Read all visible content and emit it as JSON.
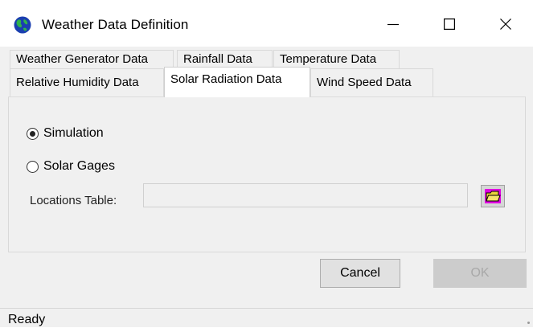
{
  "window": {
    "title": "Weather Data Definition",
    "icon": "globe-icon",
    "controls": {
      "minimize_icon": "minimize-icon",
      "maximize_icon": "maximize-icon",
      "close_icon": "close-icon"
    }
  },
  "tabs": {
    "row1": [
      {
        "label": "Weather Generator Data"
      },
      {
        "label": "Rainfall Data"
      },
      {
        "label": "Temperature Data"
      }
    ],
    "row2": [
      {
        "label": "Relative Humidity Data"
      },
      {
        "label": "Solar Radiation Data",
        "active": true
      },
      {
        "label": "Wind Speed Data"
      }
    ]
  },
  "panel": {
    "options": [
      {
        "label": "Simulation",
        "selected": true
      },
      {
        "label": "Solar Gages",
        "selected": false
      }
    ],
    "locations_label": "Locations Table:",
    "locations_value": "",
    "browse_icon": "folder-icon"
  },
  "buttons": {
    "cancel": "Cancel",
    "ok": "OK",
    "ok_enabled": false
  },
  "status": {
    "text": "Ready"
  },
  "colors": {
    "folder_button_accent": "#e000e0",
    "folder_fill": "#e8d23a",
    "disabled_text": "#a8a8a8"
  }
}
